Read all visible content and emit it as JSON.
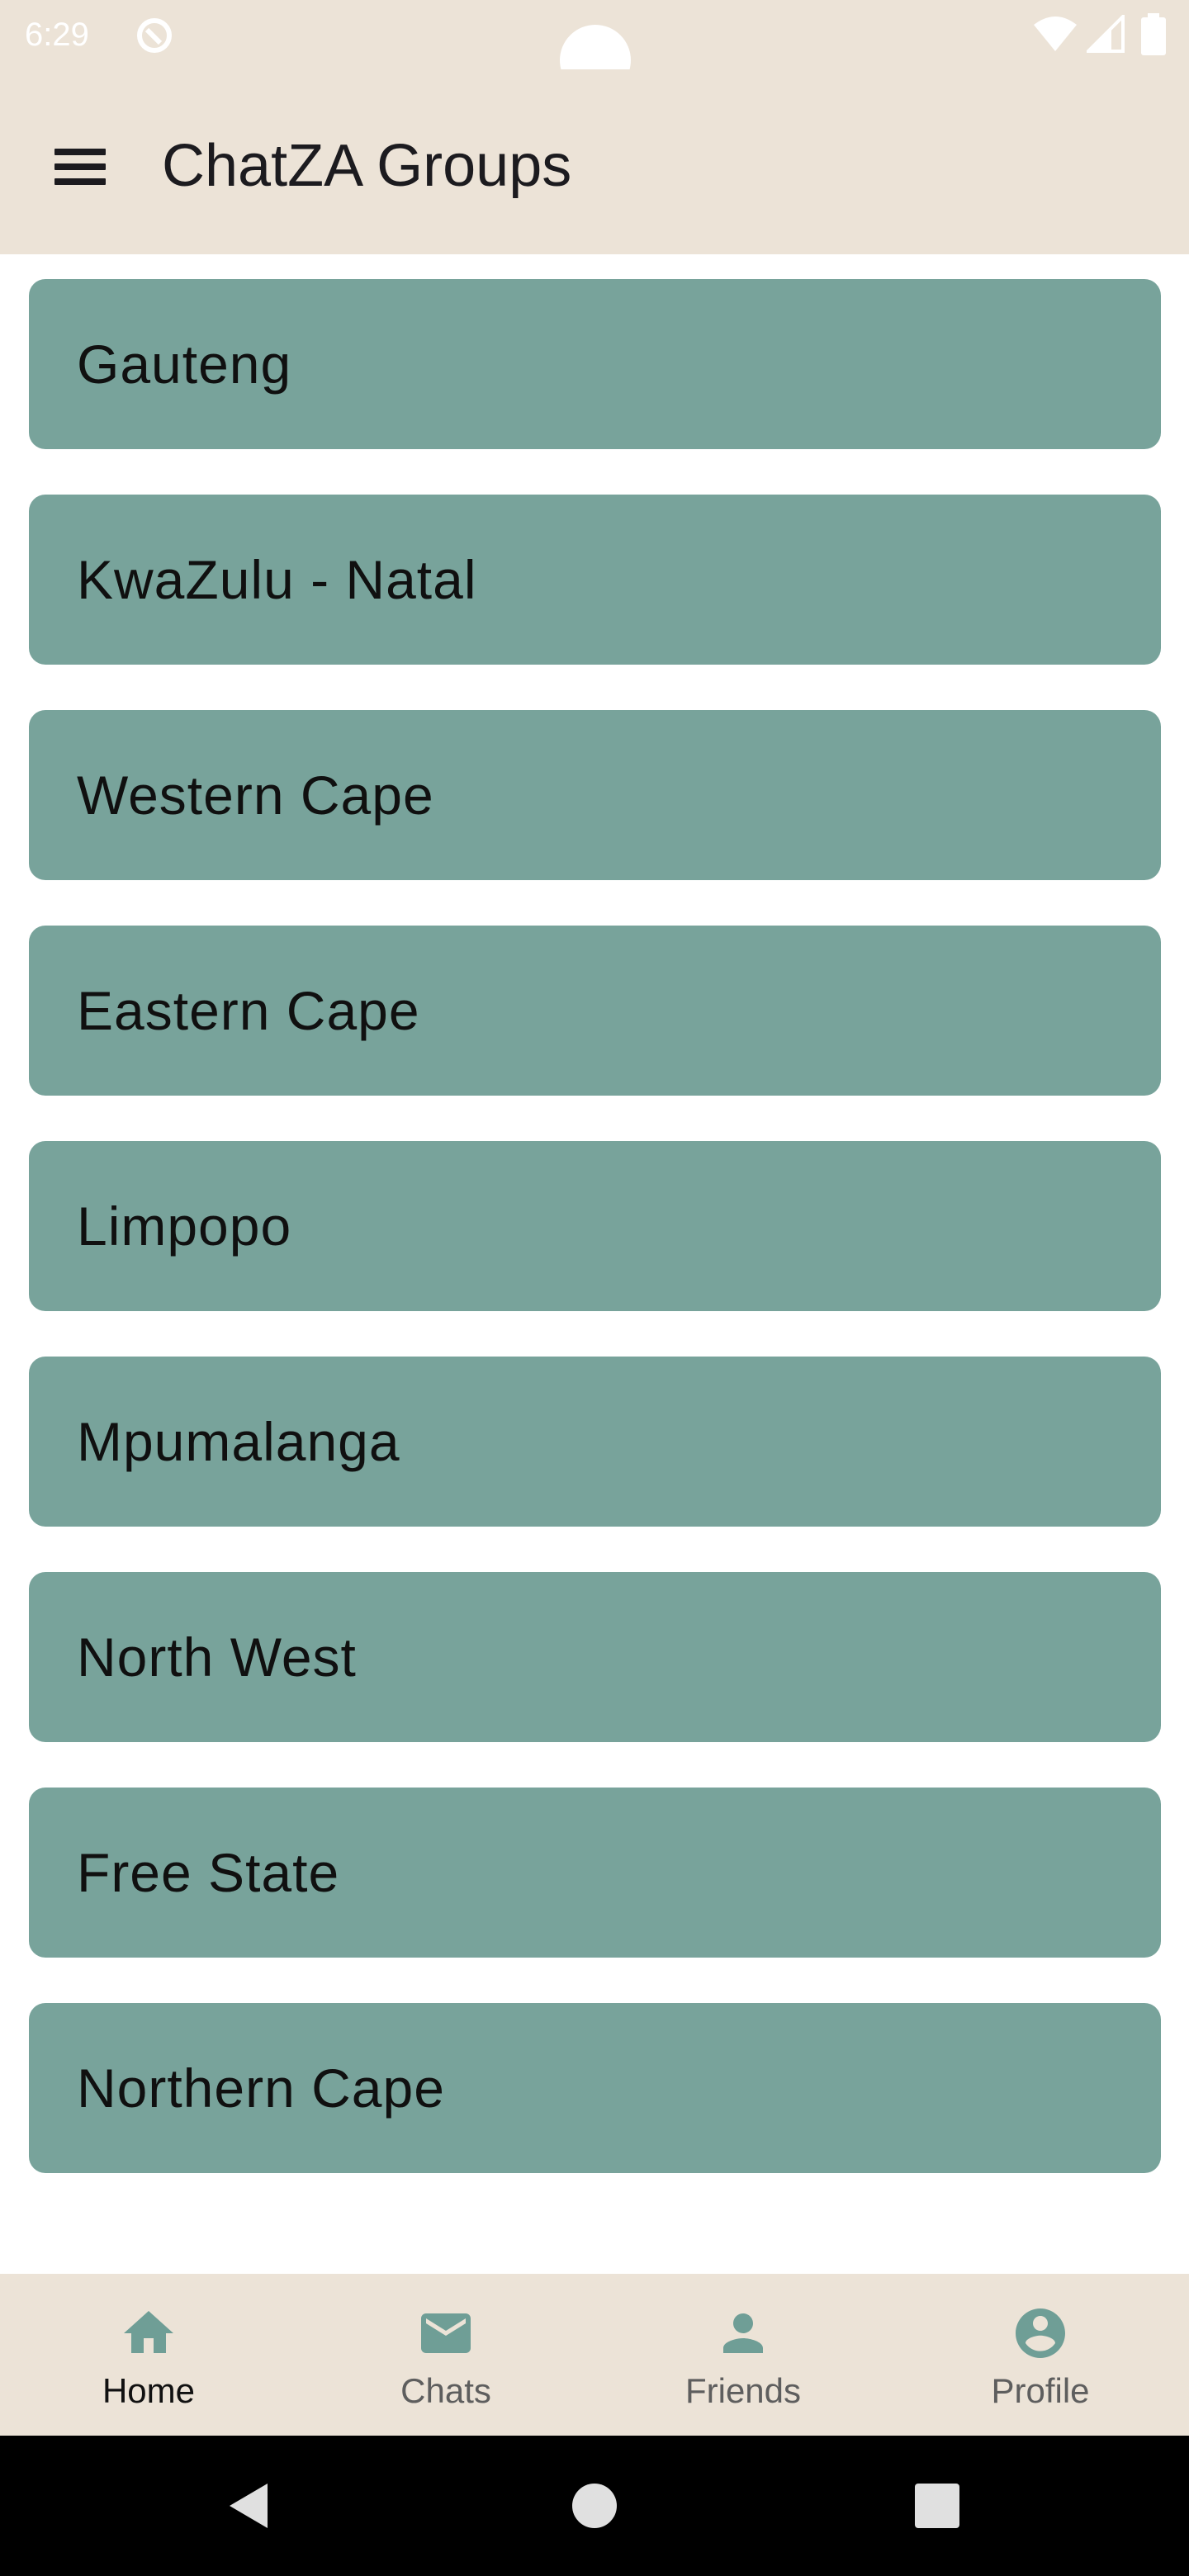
{
  "status_bar": {
    "time": "6:29",
    "icons": [
      "app-notification-icon",
      "wifi-icon",
      "cell-signal-icon",
      "battery-icon"
    ]
  },
  "app_bar": {
    "menu_icon": "hamburger-menu-icon",
    "title": "ChatZA Groups"
  },
  "groups": [
    {
      "name": "Gauteng"
    },
    {
      "name": "KwaZulu - Natal"
    },
    {
      "name": "Western Cape"
    },
    {
      "name": "Eastern Cape"
    },
    {
      "name": "Limpopo"
    },
    {
      "name": "Mpumalanga"
    },
    {
      "name": "North West"
    },
    {
      "name": "Free State"
    },
    {
      "name": "Northern Cape"
    }
  ],
  "bottom_nav": {
    "items": [
      {
        "label": "Home",
        "icon": "home-icon",
        "active": true
      },
      {
        "label": "Chats",
        "icon": "mail-icon",
        "active": false
      },
      {
        "label": "Friends",
        "icon": "person-icon",
        "active": false
      },
      {
        "label": "Profile",
        "icon": "account-circle-icon",
        "active": false
      }
    ]
  },
  "system_nav": {
    "buttons": [
      "back-icon",
      "home-circle-icon",
      "recents-icon"
    ]
  },
  "colors": {
    "surface": "#ece3d7",
    "card": "#78a39b",
    "icon_accent": "#6f9e96",
    "text_dark": "#1c1b1f"
  }
}
